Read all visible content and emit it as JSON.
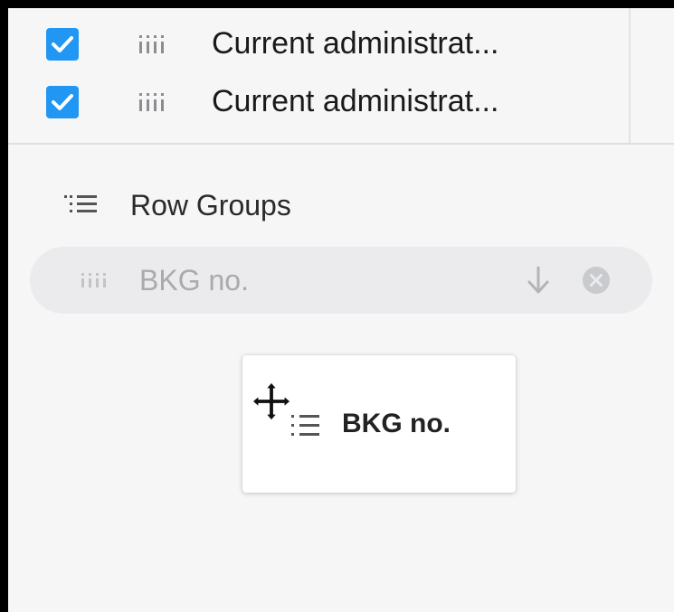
{
  "columns_panel": {
    "items": [
      {
        "checked": true,
        "label": "Current administrat..."
      },
      {
        "checked": true,
        "label": "Current administrat..."
      }
    ]
  },
  "row_groups": {
    "title": "Row Groups",
    "chips": [
      {
        "label": "BKG no.",
        "sort": "descending"
      }
    ]
  },
  "drag_ghost": {
    "label": "BKG no.",
    "cursor": "move-cursor"
  },
  "colors": {
    "checkbox": "#2196f3",
    "panel_bg": "#f6f6f7",
    "pill_bg": "#ebebed",
    "pill_text": "#a9aaad"
  },
  "icons": {
    "checkbox": "checkmark-icon",
    "drag": "drag-handle-icon",
    "row_groups": "row-group-icon",
    "sort": "arrow-down-icon",
    "remove": "close-circle-icon"
  }
}
